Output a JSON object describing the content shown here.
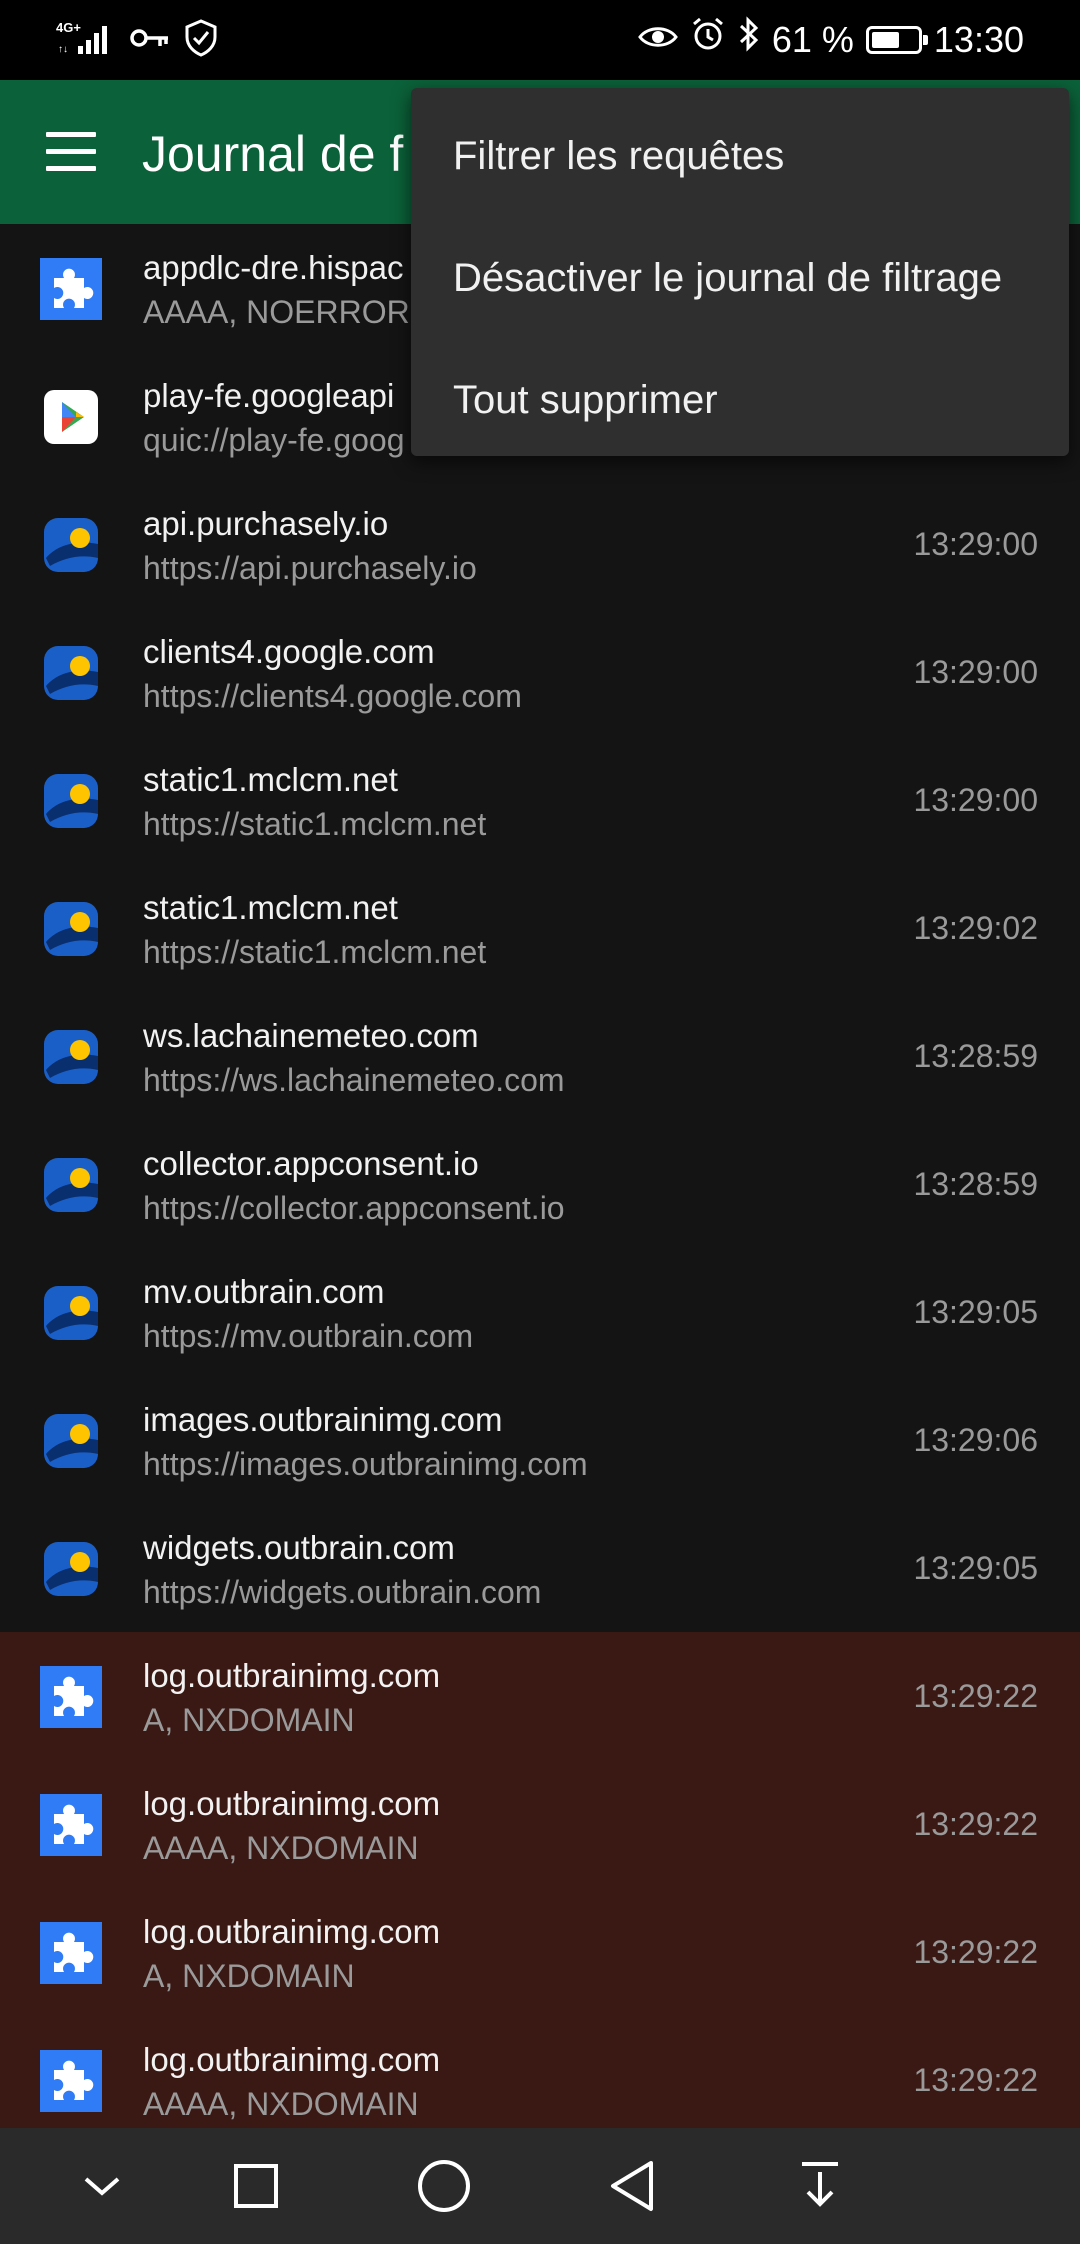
{
  "status_bar": {
    "network": "4G+",
    "battery_percent": "61 %",
    "battery_level": 0.61,
    "time": "13:30",
    "icons": [
      "signal-icon",
      "vpn-key-icon",
      "shield-check-icon",
      "eye-icon",
      "alarm-icon",
      "bluetooth-icon",
      "battery-icon"
    ]
  },
  "app_bar": {
    "title": "Journal de f",
    "menu_icon": "hamburger-menu-icon"
  },
  "overflow_menu": {
    "items": [
      {
        "label": "Filtrer les requêtes"
      },
      {
        "label": "Désactiver le journal de filtrage"
      },
      {
        "label": "Tout supprimer"
      }
    ]
  },
  "log": [
    {
      "host": "appdlc-dre.hispac",
      "detail": "AAAA, NOERROR",
      "time": "",
      "icon": "puzzle-icon",
      "blocked": false
    },
    {
      "host": "play-fe.googleapi",
      "detail": "quic://play-fe.goog",
      "time": "",
      "icon": "play-store-icon",
      "blocked": false
    },
    {
      "host": "api.purchasely.io",
      "detail": "https://api.purchasely.io",
      "time": "13:29:00",
      "icon": "weather-app-icon",
      "blocked": false
    },
    {
      "host": "clients4.google.com",
      "detail": "https://clients4.google.com",
      "time": "13:29:00",
      "icon": "weather-app-icon",
      "blocked": false
    },
    {
      "host": "static1.mclcm.net",
      "detail": "https://static1.mclcm.net",
      "time": "13:29:00",
      "icon": "weather-app-icon",
      "blocked": false
    },
    {
      "host": "static1.mclcm.net",
      "detail": "https://static1.mclcm.net",
      "time": "13:29:02",
      "icon": "weather-app-icon",
      "blocked": false
    },
    {
      "host": "ws.lachainemeteo.com",
      "detail": "https://ws.lachainemeteo.com",
      "time": "13:28:59",
      "icon": "weather-app-icon",
      "blocked": false
    },
    {
      "host": "collector.appconsent.io",
      "detail": "https://collector.appconsent.io",
      "time": "13:28:59",
      "icon": "weather-app-icon",
      "blocked": false
    },
    {
      "host": "mv.outbrain.com",
      "detail": "https://mv.outbrain.com",
      "time": "13:29:05",
      "icon": "weather-app-icon",
      "blocked": false
    },
    {
      "host": "images.outbrainimg.com",
      "detail": "https://images.outbrainimg.com",
      "time": "13:29:06",
      "icon": "weather-app-icon",
      "blocked": false
    },
    {
      "host": "widgets.outbrain.com",
      "detail": "https://widgets.outbrain.com",
      "time": "13:29:05",
      "icon": "weather-app-icon",
      "blocked": false
    },
    {
      "host": "log.outbrainimg.com",
      "detail": "A, NXDOMAIN",
      "time": "13:29:22",
      "icon": "puzzle-icon",
      "blocked": true
    },
    {
      "host": "log.outbrainimg.com",
      "detail": "AAAA, NXDOMAIN",
      "time": "13:29:22",
      "icon": "puzzle-icon",
      "blocked": true
    },
    {
      "host": "log.outbrainimg.com",
      "detail": "A, NXDOMAIN",
      "time": "13:29:22",
      "icon": "puzzle-icon",
      "blocked": true
    },
    {
      "host": "log.outbrainimg.com",
      "detail": "AAAA, NXDOMAIN",
      "time": "13:29:22",
      "icon": "puzzle-icon",
      "blocked": true
    }
  ],
  "nav_bar": {
    "buttons": [
      "chevron-down-icon",
      "recents-square-icon",
      "home-circle-icon",
      "back-triangle-icon",
      "notification-pull-icon"
    ]
  },
  "colors": {
    "app_bar": "#0b6139",
    "background": "#141414",
    "blocked_row": "#3a1915",
    "menu": "#2f2f2f",
    "puzzle_icon": "#2f7cf6"
  }
}
